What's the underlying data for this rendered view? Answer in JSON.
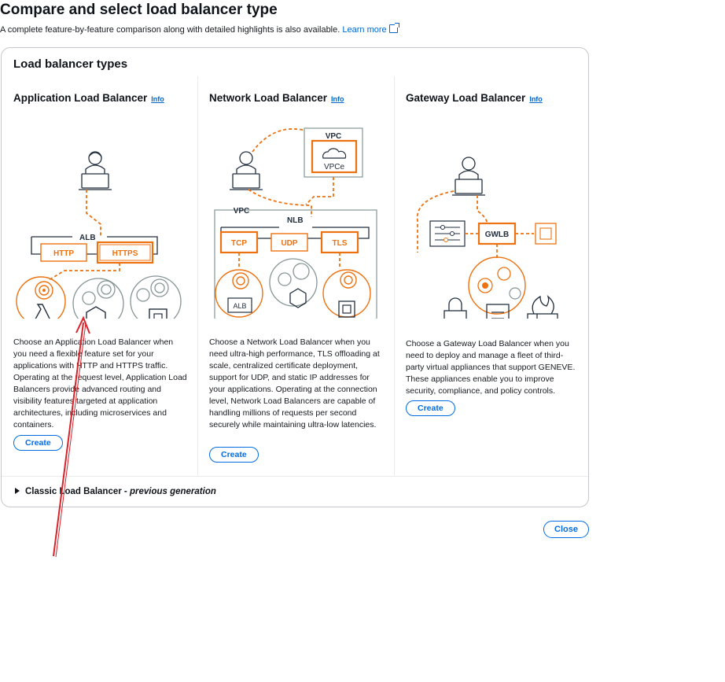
{
  "page": {
    "title": "Compare and select load balancer type",
    "subtitle": "A complete feature-by-feature comparison along with detailed highlights is also available.",
    "learn_more": "Learn more"
  },
  "card": {
    "title": "Load balancer types",
    "columns": [
      {
        "name": "Application Load Balancer",
        "info": "Info",
        "description": "Choose an Application Load Balancer when you need a flexible feature set for your applications with HTTP and HTTPS traffic. Operating at the request level, Application Load Balancers provide advanced routing and visibility features targeted at application architectures, including microservices and containers.",
        "button": "Create",
        "diagram": {
          "group": "ALB",
          "protocols": [
            "HTTP",
            "HTTPS"
          ]
        }
      },
      {
        "name": "Network Load Balancer",
        "info": "Info",
        "description": "Choose a Network Load Balancer when you need ultra-high performance, TLS offloading at scale, centralized certificate deployment, support for UDP, and static IP addresses for your applications. Operating at the connection level, Network Load Balancers are capable of handling millions of requests per second securely while maintaining ultra-low latencies.",
        "button": "Create",
        "diagram": {
          "vpc_top": "VPC",
          "vpce": "VPCe",
          "vpc": "VPC",
          "group": "NLB",
          "protocols": [
            "TCP",
            "UDP",
            "TLS"
          ],
          "target": "ALB"
        }
      },
      {
        "name": "Gateway Load Balancer",
        "info": "Info",
        "description": "Choose a Gateway Load Balancer when you need to deploy and manage a fleet of third-party virtual appliances that support GENEVE. These appliances enable you to improve security, compliance, and policy controls.",
        "button": "Create",
        "diagram": {
          "group": "GWLB"
        }
      }
    ],
    "classic": {
      "label": "Classic Load Balancer - ",
      "suffix": "previous generation"
    }
  },
  "footer": {
    "close": "Close"
  },
  "colors": {
    "accent": "#ec7211",
    "link": "#0066cc",
    "button": "#006ce0",
    "annotation": "#d8232a"
  }
}
